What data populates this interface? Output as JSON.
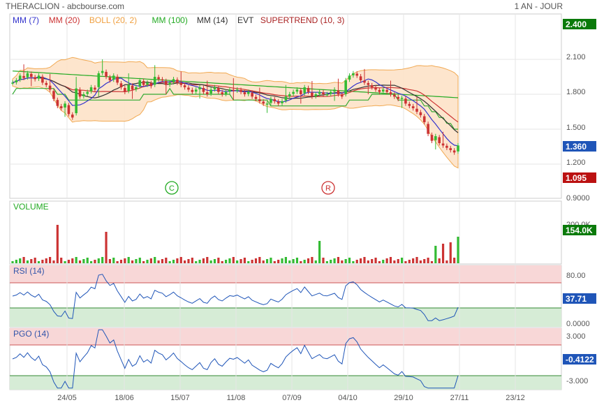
{
  "header": {
    "title": "THERACLION - abcbourse.com",
    "period": "1 AN - JOUR"
  },
  "legend": [
    {
      "label": "MM (7)",
      "color": "#3333cc"
    },
    {
      "label": "MM (20)",
      "color": "#cc3333"
    },
    {
      "label": "BOLL (20, 2)",
      "color": "#f0a040"
    },
    {
      "label": "MM (100)",
      "color": "#22aa22"
    },
    {
      "label": "MM (14)",
      "color": "#333333"
    },
    {
      "label": "EVT",
      "color": "#333333"
    },
    {
      "label": "SUPERTREND (10, 3)",
      "color": "#aa2222"
    }
  ],
  "markers": [
    {
      "label": "C",
      "date": "12/07",
      "color": "#22aa22"
    },
    {
      "label": "R",
      "date": "20/09",
      "color": "#cc3333"
    }
  ],
  "colors": {
    "up": "#33bb33",
    "down": "#cc3333",
    "accent": "#0a7a0a"
  },
  "chart_data": [
    {
      "type": "candlestick",
      "title": "THERACLION",
      "y_ticks": [
        "2.400",
        "2.100",
        "1.800",
        "1.500",
        "1.200",
        "0.9000"
      ],
      "ylim": [
        0.9,
        2.4
      ],
      "x_ticks": [
        "24/05",
        "18/06",
        "15/07",
        "11/08",
        "07/09",
        "04/10",
        "29/10",
        "27/11",
        "23/12"
      ],
      "last_price": "1.360",
      "max_badge": "2.400",
      "min_badge": "1.095",
      "close_approx": [
        1.9,
        1.92,
        1.96,
        1.94,
        1.98,
        1.95,
        1.93,
        1.96,
        1.9,
        1.88,
        1.84,
        1.76,
        1.7,
        1.68,
        1.72,
        1.63,
        1.6,
        1.85,
        1.78,
        1.8,
        1.82,
        1.86,
        1.84,
        1.98,
        2.0,
        1.95,
        1.92,
        1.96,
        1.9,
        1.86,
        1.82,
        1.88,
        1.84,
        1.86,
        1.92,
        1.88,
        1.9,
        1.87,
        1.95,
        1.93,
        1.92,
        1.88,
        1.9,
        1.93,
        1.9,
        1.88,
        1.86,
        1.84,
        1.82,
        1.84,
        1.86,
        1.82,
        1.8,
        1.84,
        1.86,
        1.82,
        1.8,
        1.82,
        1.84,
        1.83,
        1.84,
        1.82,
        1.8,
        1.82,
        1.78,
        1.76,
        1.74,
        1.72,
        1.72,
        1.76,
        1.74,
        1.72,
        1.74,
        1.78,
        1.8,
        1.82,
        1.84,
        1.8,
        1.86,
        1.82,
        1.78,
        1.8,
        1.82,
        1.8,
        1.8,
        1.82,
        1.84,
        1.8,
        1.78,
        1.92,
        1.96,
        1.98,
        1.96,
        1.92,
        1.9,
        1.88,
        1.86,
        1.84,
        1.82,
        1.84,
        1.82,
        1.8,
        1.78,
        1.76,
        1.77,
        1.72,
        1.7,
        1.68,
        1.65,
        1.62,
        1.56,
        1.46,
        1.4,
        1.44,
        1.38,
        1.36,
        1.34,
        1.32,
        1.3,
        1.36
      ],
      "ma100_approx": [
        2.0,
        1.77
      ]
    },
    {
      "type": "bar",
      "title": "VOLUME",
      "y_ticks": [
        "200.0K"
      ],
      "last_value": "154.0K",
      "peaks": [
        {
          "date": "01/06",
          "value": 300000
        },
        {
          "date": "12/06",
          "value": 210000
        },
        {
          "date": "15/09",
          "value": 135000
        },
        {
          "date": "25/11",
          "value": 175000
        }
      ]
    },
    {
      "type": "line",
      "title": "RSI (14)",
      "y_ticks": [
        "80.00",
        "0.0000"
      ],
      "ylim": [
        0,
        100
      ],
      "bands": {
        "overbought": 70,
        "oversold": 30
      },
      "last_value": "37.71"
    },
    {
      "type": "line",
      "title": "PGO (14)",
      "y_ticks": [
        "3.000",
        "-3.000"
      ],
      "ylim": [
        -4,
        4
      ],
      "bands": {
        "upper": 3,
        "lower": -3
      },
      "last_value": "-0.4122"
    }
  ]
}
